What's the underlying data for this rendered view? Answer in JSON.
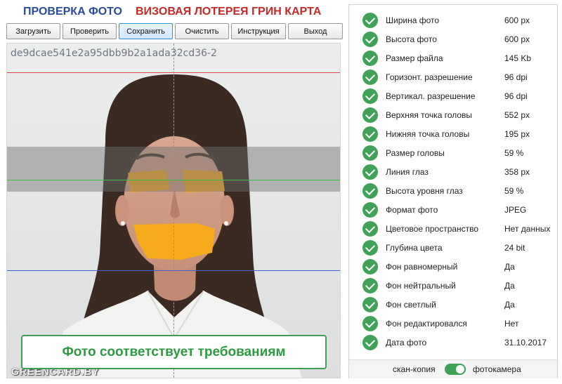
{
  "header": {
    "title_left": "ПРОВЕРКА ФОТО",
    "title_right": "ВИЗОВАЯ ЛОТЕРЕЯ ГРИН КАРТА"
  },
  "toolbar": {
    "buttons": [
      "Загрузить",
      "Проверить",
      "Сохранить",
      "Очистить",
      "Инструкция",
      "Выход"
    ],
    "active": "Сохранить"
  },
  "photo": {
    "id": "de9dcae541e2a95dbb9b2a1ada32cd36-2",
    "watermark": "GREENCARD.BY",
    "result": "Фото соответствует требованиям"
  },
  "checks": [
    {
      "label": "Ширина фото",
      "value": "600 px"
    },
    {
      "label": "Высота фото",
      "value": "600 px"
    },
    {
      "label": "Размер файла",
      "value": "145 Kb"
    },
    {
      "label": "Горизонт. разрешение",
      "value": "96 dpi"
    },
    {
      "label": "Вертикал. разрешение",
      "value": "96 dpi"
    },
    {
      "label": "Верхняя точка головы",
      "value": "552 px"
    },
    {
      "label": "Нижняя точка головы",
      "value": "195 px"
    },
    {
      "label": "Размер головы",
      "value": "59 %"
    },
    {
      "label": "Линия глаз",
      "value": "358 px"
    },
    {
      "label": "Высота уровня глаз",
      "value": "59 %"
    },
    {
      "label": "Формат фото",
      "value": "JPEG"
    },
    {
      "label": "Цветовое пространство",
      "value": "Нет данных"
    },
    {
      "label": "Глубина цвета",
      "value": "24 bit"
    },
    {
      "label": "Фон равномерный",
      "value": "Да"
    },
    {
      "label": "Фон нейтральный",
      "value": "Да"
    },
    {
      "label": "Фон светлый",
      "value": "Да"
    },
    {
      "label": "Фон редактировался",
      "value": "Нет"
    },
    {
      "label": "Дата фото",
      "value": "31.10.2017"
    }
  ],
  "switch": {
    "left_label": "скан-копия",
    "right_label": "фотокамера",
    "selected": "фотокамера"
  },
  "colors": {
    "title_blue": "#2a4a9c",
    "title_red": "#c62828",
    "ok_green": "#3fa257"
  }
}
